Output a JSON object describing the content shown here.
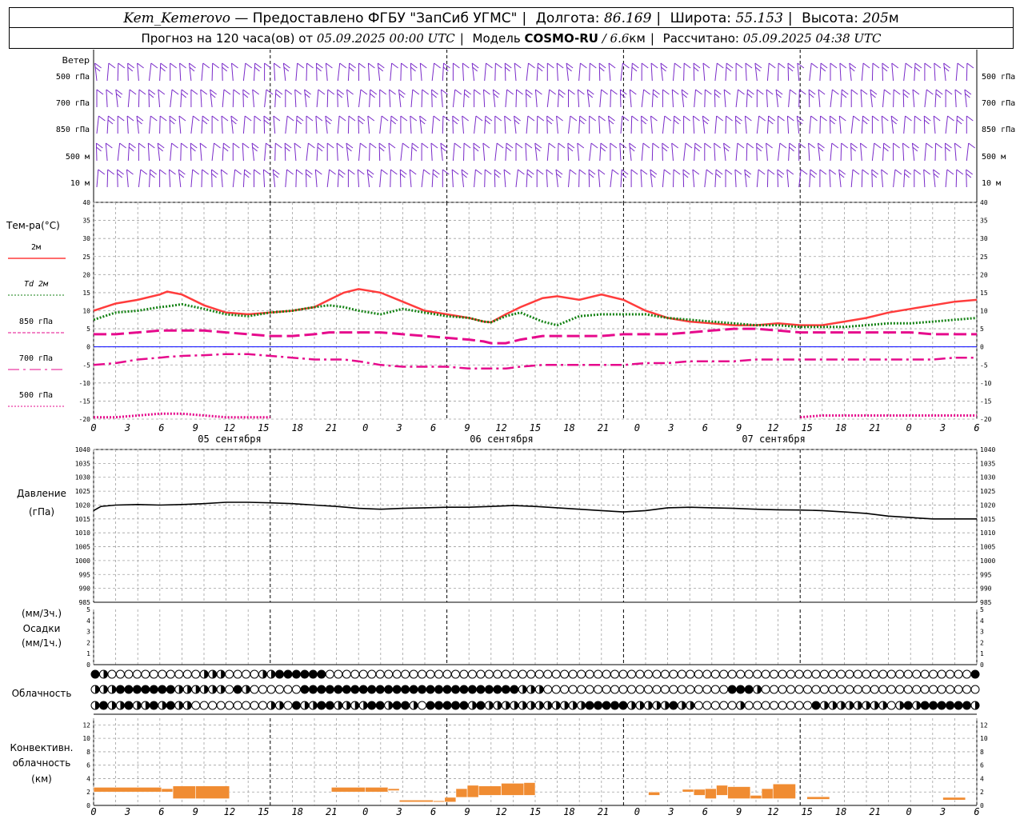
{
  "header": {
    "station": "Kem_Kemerovo",
    "provider": "— Предоставлено ФГБУ \"ЗапСиб УГМС\"",
    "lon_label": "Долгота:",
    "lon_value": "86.169",
    "lat_label": "Широта:",
    "lat_value": "55.153",
    "alt_label": "Высота:",
    "alt_value": "205",
    "alt_unit": "м",
    "forecast_label": "Прогноз на 120 часа(ов) от",
    "forecast_start": "05.09.2025 00:00 UTC",
    "model_label": "Модель",
    "model_name": "COSMO-RU",
    "model_res": "/ 6.6",
    "model_res_unit": "км",
    "computed_label": "Рассчитано:",
    "computed_value": "05.09.2025 04:38 UTC"
  },
  "colors": {
    "t2m": "#ff3c3c",
    "td2m": "#148214",
    "t850": "#e60a8c",
    "t700": "#e60a8c",
    "t500": "#e60a8c",
    "wind": "#7828c8",
    "pressure": "#000000",
    "convective": "#f08c32",
    "grid": "#a0a0a0",
    "zero_line": "#0000ff"
  },
  "chart_data": [
    {
      "type": "wind_barbs",
      "title": "Ветер",
      "levels": [
        "500 гПа",
        "700 гПа",
        "850 гПа",
        "500 м",
        "10  м"
      ],
      "x_hours": [
        0,
        120
      ]
    },
    {
      "type": "line",
      "title": "Тем-ра(°C)",
      "ylim": [
        -20,
        40
      ],
      "yticks": [
        40,
        35,
        30,
        25,
        20,
        15,
        10,
        5,
        0,
        -5,
        -10,
        -15,
        -20
      ],
      "x": [
        0,
        3,
        6,
        9,
        10,
        12,
        15,
        18,
        21,
        24,
        27,
        30,
        32,
        34,
        36,
        39,
        42,
        45,
        48,
        51,
        53,
        54,
        56,
        58,
        61,
        63,
        66,
        69,
        72,
        75,
        78,
        81,
        84,
        87,
        90,
        93,
        96,
        99,
        102,
        105,
        108,
        111,
        114,
        117,
        120
      ],
      "series": [
        {
          "name": "2м",
          "style": "solid",
          "values": [
            10,
            12,
            13,
            14.5,
            15.3,
            14.5,
            11.5,
            9.5,
            9,
            9.5,
            10,
            11,
            13,
            15,
            16,
            15,
            12.5,
            10,
            9,
            8,
            7,
            6.8,
            9,
            11,
            13.5,
            14,
            13,
            14.5,
            13,
            10,
            8,
            7,
            6.5,
            6,
            6,
            6.5,
            6,
            6,
            7,
            8,
            9.5,
            10.5,
            11.5,
            12.5,
            13
          ]
        },
        {
          "name": "Td  2м",
          "style": "dotted",
          "values": [
            7.5,
            9.5,
            10,
            11,
            11.2,
            11.8,
            10.5,
            9,
            8.5,
            9.5,
            10,
            11,
            11.5,
            11,
            10,
            9,
            10.5,
            9.5,
            8.5,
            8,
            7,
            6.8,
            8.5,
            9.5,
            7,
            6,
            8.5,
            9,
            9,
            9,
            8,
            7.5,
            7,
            6.5,
            6,
            6,
            5.5,
            5.5,
            5.5,
            6,
            6.5,
            6.5,
            7,
            7.5,
            8
          ]
        },
        {
          "name": "850 гПа",
          "style": "dashed",
          "values": [
            3.5,
            3.5,
            4,
            4.5,
            4.5,
            4.5,
            4.5,
            4,
            3.5,
            3,
            3,
            3.5,
            4,
            4,
            4,
            4,
            3.5,
            3,
            2.5,
            2,
            1.5,
            1,
            1,
            2,
            3,
            3,
            3,
            3,
            3.5,
            3.5,
            3.5,
            4,
            4.5,
            5,
            5,
            4.5,
            4,
            4,
            4,
            4,
            4,
            4,
            3.5,
            3.5,
            3.5
          ]
        },
        {
          "name": "700 гПа",
          "style": "dashdot",
          "values": [
            -5,
            -4.5,
            -3.5,
            -3,
            -2.8,
            -2.5,
            -2.3,
            -2,
            -2,
            -2.5,
            -3,
            -3.5,
            -3.5,
            -3.5,
            -4,
            -5,
            -5.5,
            -5.5,
            -5.5,
            -6,
            -6,
            -6,
            -6,
            -5.5,
            -5,
            -5,
            -5,
            -5,
            -5,
            -4.5,
            -4.5,
            -4,
            -4,
            -4,
            -3.5,
            -3.5,
            -3.5,
            -3.5,
            -3.5,
            -3.5,
            -3.5,
            -3.5,
            -3.5,
            -3,
            -3
          ]
        },
        {
          "name": "500 гПа",
          "style": "dotted",
          "values": [
            -19.5,
            -19.5,
            -19,
            -18.5,
            -18.5,
            -18.5,
            -19,
            -19.5,
            -19.5,
            -19.5,
            null,
            null,
            null,
            null,
            null,
            null,
            null,
            null,
            null,
            null,
            null,
            null,
            null,
            null,
            null,
            null,
            null,
            null,
            null,
            null,
            null,
            null,
            null,
            null,
            null,
            null,
            -19.5,
            -19,
            -19,
            -19,
            -19,
            -19,
            -19,
            -19,
            -19
          ]
        }
      ]
    },
    {
      "type": "line",
      "title": "Давление",
      "ylabel": "(гПа)",
      "ylim": [
        985,
        1040
      ],
      "yticks": [
        1040,
        1035,
        1030,
        1025,
        1020,
        1015,
        1010,
        1005,
        1000,
        995,
        990,
        985
      ],
      "x": [
        0,
        1,
        3,
        6,
        9,
        12,
        15,
        18,
        21,
        24,
        27,
        30,
        33,
        36,
        39,
        42,
        45,
        48,
        51,
        54,
        57,
        60,
        63,
        66,
        69,
        72,
        75,
        78,
        81,
        84,
        87,
        90,
        93,
        96,
        99,
        102,
        105,
        108,
        111,
        114,
        117,
        120
      ],
      "series": [
        {
          "name": "Давление",
          "values": [
            1018,
            1019.5,
            1020,
            1020.2,
            1020,
            1020.2,
            1020.5,
            1021,
            1021,
            1020.8,
            1020.5,
            1020,
            1019.5,
            1018.8,
            1018.5,
            1018.8,
            1019,
            1019.2,
            1019.2,
            1019.5,
            1019.8,
            1019.5,
            1019,
            1018.5,
            1018,
            1017.5,
            1018,
            1019,
            1019.2,
            1019,
            1018.8,
            1018.5,
            1018.3,
            1018.2,
            1018,
            1017.5,
            1017,
            1016,
            1015.5,
            1015,
            1015,
            1015
          ]
        }
      ]
    },
    {
      "type": "bar",
      "title": "Осадки",
      "ylabel_top": "(мм/3ч.)",
      "ylabel_bottom": "(мм/1ч.)",
      "ylim": [
        0,
        5
      ],
      "yticks": [
        5,
        4,
        3,
        2,
        1,
        0
      ],
      "series": []
    },
    {
      "type": "table",
      "title": "Облачность",
      "rows": [
        "3211111111111222111122333333111111111111111111111111111111111111111111111111111111111111111111111111111113",
        "2223333333222222132111111333333333333333333333333332221111111111111111111111333211111111111111111111111111",
        "2322322323221111111112213223322223323321333332322222222222233333222223221111121111111132222222212323333332"
      ]
    },
    {
      "type": "bar",
      "title": "Конвективн. облачность",
      "ylabel": "(км)",
      "ylim": [
        0,
        13
      ],
      "yticks": [
        12,
        10,
        8,
        6,
        4,
        2,
        0
      ],
      "series": [
        {
          "name": "Конвективн. облачность",
          "segments": [
            [
              0,
              6,
              2.0,
              2.7
            ],
            [
              6,
              7,
              2.0,
              2.5
            ],
            [
              7,
              9,
              1.0,
              2.9
            ],
            [
              9,
              12,
              1.0,
              2.9
            ],
            [
              21,
              24,
              2.0,
              2.7
            ],
            [
              24,
              26,
              2.0,
              2.7
            ],
            [
              26,
              27,
              2.2,
              2.5
            ],
            [
              27,
              30,
              0.5,
              0.8
            ],
            [
              30,
              31,
              0.5,
              0.7
            ],
            [
              31,
              32,
              0.5,
              1.2
            ],
            [
              32,
              33,
              1.2,
              2.5
            ],
            [
              33,
              34,
              1.2,
              3.0
            ],
            [
              34,
              36,
              1.5,
              2.9
            ],
            [
              36,
              38,
              1.5,
              3.3
            ],
            [
              38,
              39,
              1.5,
              3.4
            ],
            [
              49,
              50,
              1.5,
              2.0
            ],
            [
              52,
              53,
              2.0,
              2.4
            ],
            [
              53,
              54,
              1.5,
              2.4
            ],
            [
              54,
              55,
              1.0,
              2.5
            ],
            [
              55,
              56,
              1.5,
              3.0
            ],
            [
              56,
              58,
              1.0,
              2.8
            ],
            [
              58,
              59,
              1.0,
              1.5
            ],
            [
              59,
              60,
              1.0,
              2.5
            ],
            [
              60,
              62,
              1.0,
              3.2
            ],
            [
              63,
              65,
              0.9,
              1.3
            ],
            [
              75,
              77,
              0.8,
              1.2
            ]
          ]
        }
      ]
    }
  ],
  "axis": {
    "hour_labels": [
      "0",
      "3",
      "6",
      "9",
      "12",
      "15",
      "18",
      "21",
      "0",
      "3",
      "6",
      "9",
      "12",
      "15",
      "18",
      "21",
      "0",
      "3",
      "6",
      "9",
      "12",
      "15",
      "18",
      "21",
      "0",
      "3",
      "6"
    ],
    "dates": [
      {
        "label": "05 сентября",
        "hour": 12
      },
      {
        "label": "06 сентября",
        "hour": 36
      },
      {
        "label": "07 сентября",
        "hour": 60
      }
    ]
  }
}
